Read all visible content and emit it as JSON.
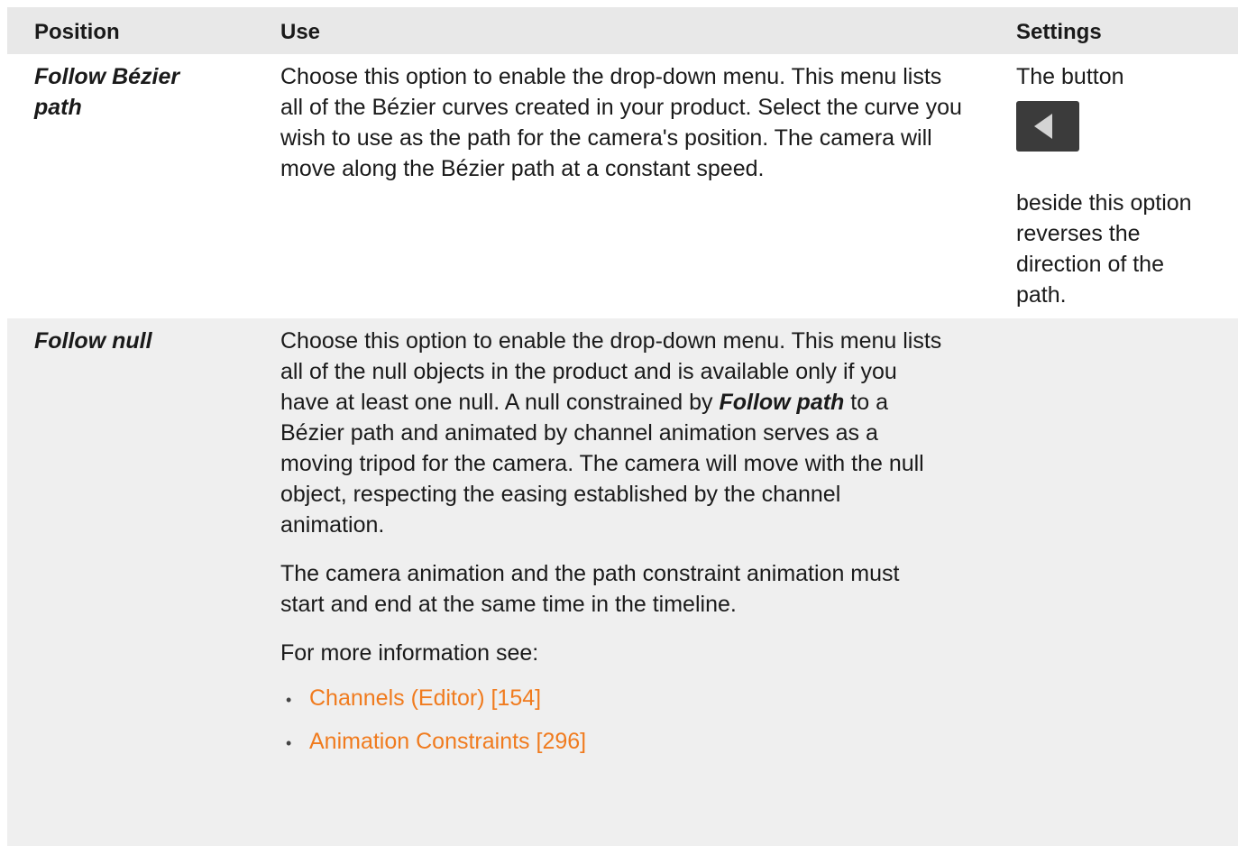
{
  "table": {
    "headers": [
      "Position",
      "Use",
      "Settings"
    ],
    "rows": [
      {
        "position": "Follow Bézier path",
        "use_paragraphs": [
          "Choose this option to enable the drop-down menu. This menu lists all of the Bézier curves created in your product. Select the curve you wish to use as the path for the camera's position. The camera will move along the Bézier path at a constant speed."
        ],
        "settings_before": "The button",
        "settings_icon": "reverse-direction-icon",
        "settings_after": "beside this option reverses the direction of the path."
      },
      {
        "position": "Follow null",
        "use_p1_a": "Choose this option to enable the drop-down menu. This menu lists all of the null objects in the product and is available only if you have at least one null. A null constrained by ",
        "use_p1_bold": "Follow path",
        "use_p1_b": " to a Bézier path and animated by channel animation serves as a moving tripod for the camera. The camera will move with the null object, respecting the easing established by the channel animation.",
        "use_p2": "The camera animation and the path constraint animation must start and end at the same time in the timeline.",
        "use_p3": "For more information see:",
        "links": [
          {
            "bullet": "•",
            "label": "Channels (Editor) [154]"
          },
          {
            "bullet": "•",
            "label": "Animation Constraints [296]"
          }
        ]
      }
    ]
  },
  "colors": {
    "header_bg": "#e8e8e8",
    "alt_row_bg": "#efefef",
    "link": "#f07b1e",
    "button_bg": "#3b3b3b"
  }
}
